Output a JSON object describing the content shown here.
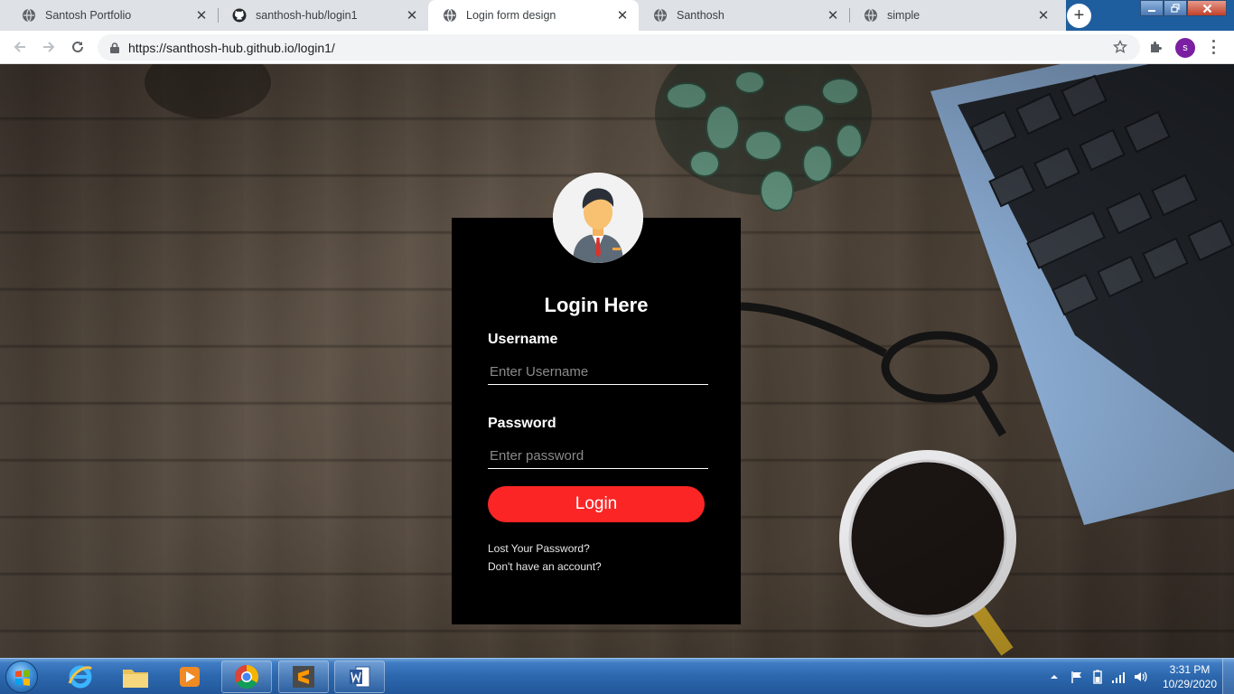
{
  "browser": {
    "tabs": [
      {
        "label": "Santosh Portfolio",
        "icon": "globe-icon",
        "active": false
      },
      {
        "label": "santhosh-hub/login1",
        "icon": "github-icon",
        "active": false
      },
      {
        "label": "Login form design",
        "icon": "globe-icon",
        "active": true
      },
      {
        "label": "Santhosh",
        "icon": "globe-icon",
        "active": false
      },
      {
        "label": "simple",
        "icon": "globe-icon",
        "active": false
      }
    ],
    "tab_close_glyph": "✕",
    "new_tab_glyph": "+",
    "url": "https://santhosh-hub.github.io/login1/",
    "profile_initial": "s",
    "colors": {
      "titlebar": "#1f5e9e",
      "tabstrip": "#dee1e6",
      "profile": "#7b1fa2"
    }
  },
  "login": {
    "title": "Login Here",
    "username_label": "Username",
    "username_placeholder": "Enter Username",
    "password_label": "Password",
    "password_placeholder": "Enter password",
    "button_label": "Login",
    "lost_password": "Lost Your Password?",
    "signup_prompt": "Don't have an account?",
    "colors": {
      "card": "#000000",
      "button": "#fb2525",
      "text": "#ffffff"
    }
  },
  "taskbar": {
    "pinned": [
      "start-orb",
      "internet-explorer-icon",
      "file-explorer-icon",
      "media-player-icon",
      "chrome-icon",
      "sublime-text-icon",
      "word-icon"
    ],
    "time": "3:31 PM",
    "date": "10/29/2020"
  }
}
